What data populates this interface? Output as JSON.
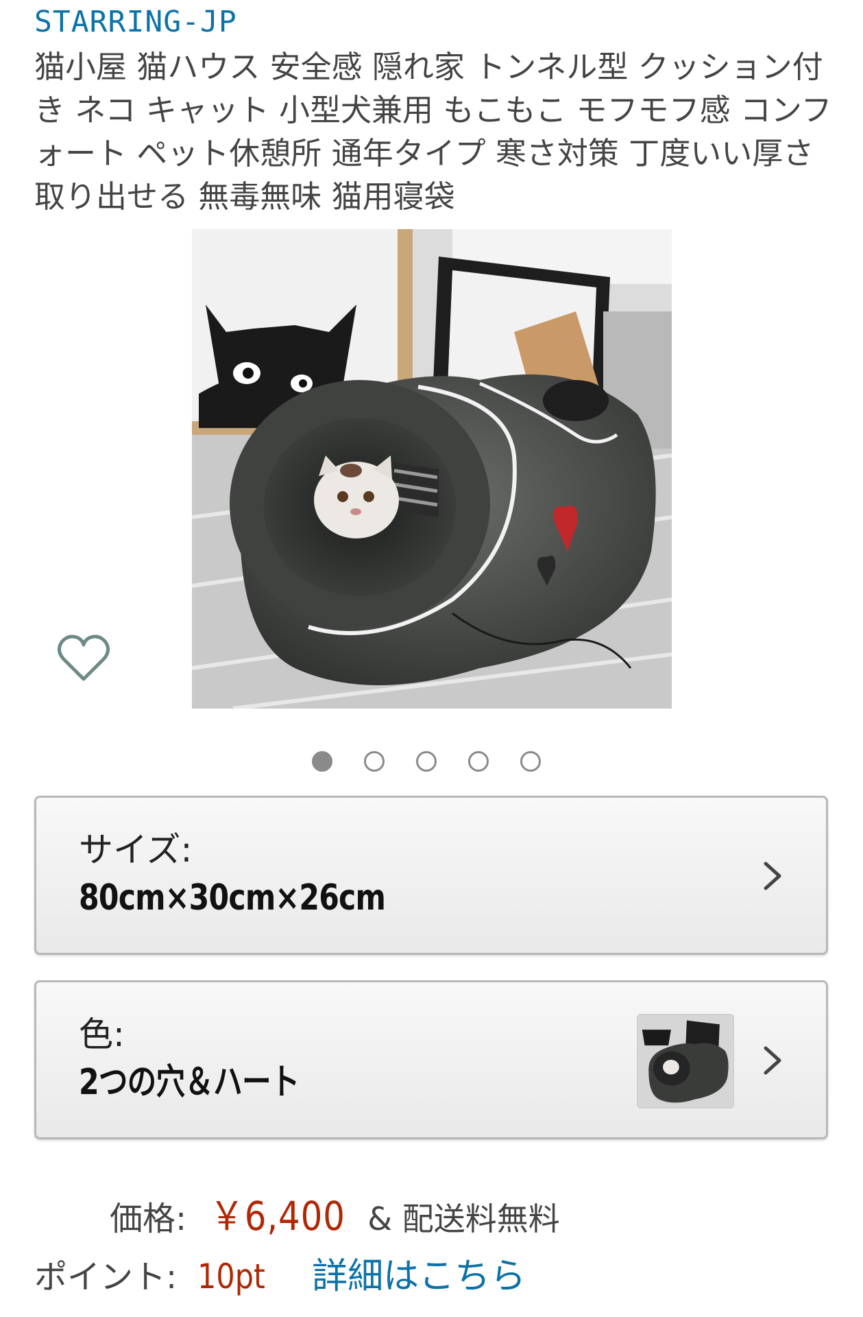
{
  "brand": "STARRING-JP",
  "title": "猫小屋 猫ハウス 安全感 隠れ家 トンネル型 クッション付き ネコ キャット 小型犬兼用 もこもこ モフモフ感 コンフォート ペット休憩所 通年タイプ 寒さ対策 丁度いい厚さ 取り出せる 無毒無味 猫用寝袋",
  "image": {
    "subject": "product-photo",
    "carousel_total": 5,
    "carousel_active": 1
  },
  "wishlist_icon": "heart-outline-icon",
  "options": {
    "size": {
      "label": "サイズ:",
      "value": "80cm×30cm×26cm"
    },
    "color": {
      "label": "色:",
      "value": "2つの穴＆ハート"
    }
  },
  "price": {
    "label": "価格:",
    "value": "￥6,400",
    "shipping": "& 配送料無料"
  },
  "points": {
    "label": "ポイント:",
    "value": "10pt",
    "link": "詳細はこちら"
  },
  "colors": {
    "link": "#0b72a8",
    "price": "#b12704",
    "text": "#444444"
  }
}
